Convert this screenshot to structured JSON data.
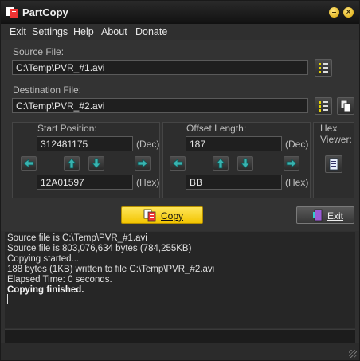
{
  "window": {
    "title": "PartCopy"
  },
  "menu": [
    "Exit",
    "Settings",
    "Help",
    "About",
    "Donate"
  ],
  "source": {
    "label": "Source File:",
    "value": "C:\\Temp\\PVR_#1.avi"
  },
  "destination": {
    "label": "Destination File:",
    "value": "C:\\Temp\\PVR_#2.avi"
  },
  "start": {
    "label": "Start Position:",
    "dec": "312481175",
    "hex": "12A01597",
    "dec_unit": "(Dec)",
    "hex_unit": "(Hex)"
  },
  "offset": {
    "label": "Offset Length:",
    "dec": "187",
    "hex": "BB",
    "dec_unit": "(Dec)",
    "hex_unit": "(Hex)"
  },
  "hex_viewer": {
    "label_line1": "Hex",
    "label_line2": "Viewer:"
  },
  "buttons": {
    "copy": "Copy",
    "exit": "Exit"
  },
  "log": [
    "Source file is C:\\Temp\\PVR_#1.avi",
    "Source file is 803,076,634 bytes (784,255KB)",
    "Copying started...",
    "188 bytes (1KB) written to file C:\\Temp\\PVR_#2.avi",
    "Elapsed Time: 0 seconds.",
    "Copying finished."
  ],
  "colors": {
    "accent": "#f2c400",
    "arrow": "#39b3b0"
  }
}
